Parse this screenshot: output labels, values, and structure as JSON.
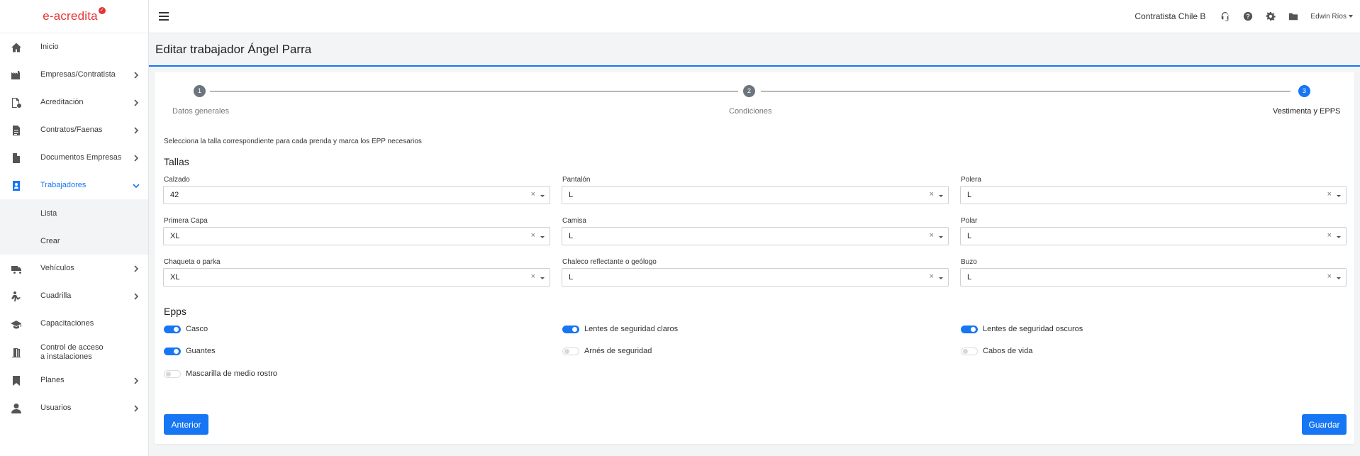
{
  "brand": {
    "logo_text": "e-acredita",
    "logo_badge": "✓",
    "accent": "#1676f3",
    "logo_color": "#e23434"
  },
  "sidebar": {
    "items": [
      {
        "label": "Inicio",
        "icon": "home-icon",
        "chevron": false
      },
      {
        "label": "Empresas/Contratista",
        "icon": "factory-icon",
        "chevron": true
      },
      {
        "label": "Acreditación",
        "icon": "accreditation-icon",
        "chevron": true
      },
      {
        "label": "Contratos/Faenas",
        "icon": "contract-icon",
        "chevron": true
      },
      {
        "label": "Documentos Empresas",
        "icon": "document-icon",
        "chevron": true
      },
      {
        "label": "Trabajadores",
        "icon": "worker-badge-icon",
        "chevron": true,
        "active": true
      },
      {
        "label": "Vehículos",
        "icon": "truck-icon",
        "chevron": true
      },
      {
        "label": "Cuadrilla",
        "icon": "crew-icon",
        "chevron": true
      },
      {
        "label": "Capacitaciones",
        "icon": "graduation-cap-icon",
        "chevron": false
      },
      {
        "label": "Control de acceso a instalaciones",
        "label_line1": "Control de acceso",
        "label_line2": "a instalaciones",
        "icon": "door-icon",
        "chevron": false
      },
      {
        "label": "Planes",
        "icon": "bookmark-icon",
        "chevron": true
      },
      {
        "label": "Usuarios",
        "icon": "user-icon",
        "chevron": true
      }
    ],
    "sub_items": [
      {
        "label": "Lista"
      },
      {
        "label": "Crear"
      }
    ]
  },
  "header": {
    "company": "Contratista Chile B",
    "user": "Edwin Ríos",
    "icons": [
      "headset-icon",
      "help-icon",
      "gear-icon",
      "folder-icon"
    ]
  },
  "page": {
    "title": "Editar trabajador Ángel Parra"
  },
  "stepper": {
    "steps": [
      {
        "number": "1",
        "label": "Datos generales",
        "active": false
      },
      {
        "number": "2",
        "label": "Condiciones",
        "active": false
      },
      {
        "number": "3",
        "label": "Vestimenta y EPPS",
        "active": true
      }
    ]
  },
  "form": {
    "instructions": "Selecciona la talla correspondiente para cada prenda y marca los EPP necesarios",
    "tallas_title": "Tallas",
    "fields": [
      {
        "label": "Calzado",
        "value": "42"
      },
      {
        "label": "Pantalón",
        "value": "L"
      },
      {
        "label": "Polera",
        "value": "L"
      },
      {
        "label": "Primera Capa",
        "value": "XL"
      },
      {
        "label": "Camisa",
        "value": "L"
      },
      {
        "label": "Polar",
        "value": "L"
      },
      {
        "label": "Chaqueta o parka",
        "value": "XL"
      },
      {
        "label": "Chaleco reflectante o geólogo",
        "value": "L"
      },
      {
        "label": "Buzo",
        "value": "L"
      }
    ],
    "clear_symbol": "×",
    "epps_title": "Epps",
    "epps": [
      {
        "label": "Casco",
        "checked": true
      },
      {
        "label": "Lentes de seguridad claros",
        "checked": true
      },
      {
        "label": "Lentes de seguridad oscuros",
        "checked": true
      },
      {
        "label": "Guantes",
        "checked": true
      },
      {
        "label": "Arnés de seguridad",
        "checked": false
      },
      {
        "label": "Cabos de vida",
        "checked": false
      },
      {
        "label": "Mascarilla de medio rostro",
        "checked": false
      }
    ],
    "prev_label": "Anterior",
    "save_label": "Guardar"
  }
}
